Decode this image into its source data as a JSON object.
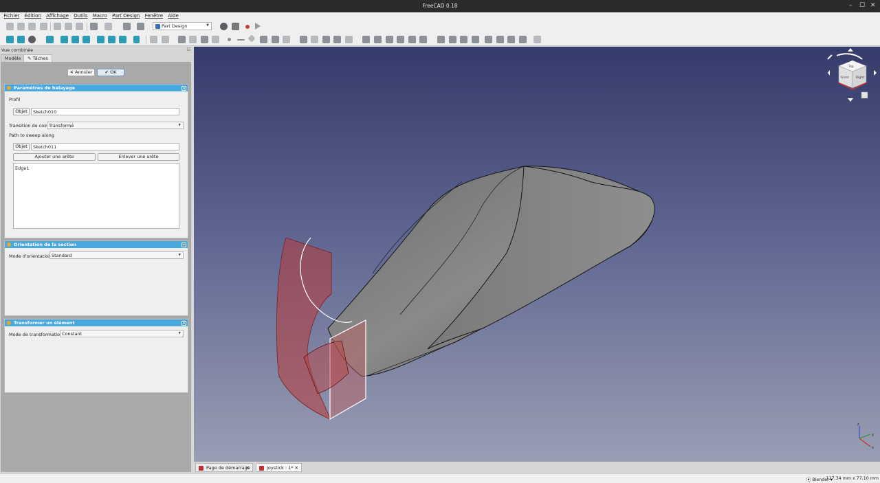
{
  "window": {
    "title": "FreeCAD 0.18",
    "minimize": "–",
    "maximize": "☐",
    "close": "✕"
  },
  "menu": [
    "Fichier",
    "Édition",
    "Affichage",
    "Macro",
    "Outils",
    "Macro",
    "Part Design",
    "Fenêtre",
    "Aide"
  ],
  "toolbar": {
    "workbench": "Part Design",
    "workbench_arrow": "▼"
  },
  "panel": {
    "title": "Vue combinée",
    "tabs": {
      "modele": "Modèle",
      "taches": "Tâches"
    },
    "buttons": {
      "annuler": "Annuler",
      "ok": "OK",
      "annuler_icon": "✕",
      "ok_icon": "✔"
    },
    "sweep": {
      "title": "Paramètres de balayage",
      "profil_label": "Profil",
      "objet1_btn": "Objet",
      "profile_value": "Sketch010",
      "transition_label": "Transition de coin",
      "transition_value": "Transformé",
      "path_label": "Path to sweep along",
      "objet2_btn": "Objet",
      "path_value": "Sketch011",
      "add_edge": "Ajouter une arête",
      "remove_edge": "Enlever une arête",
      "edges": [
        "Edge1"
      ]
    },
    "orientation": {
      "title": "Orientation de la section",
      "mode_label": "Mode d'orientation",
      "mode_value": "Standard"
    },
    "transform": {
      "title": "Transformer un élément",
      "mode_label": "Mode de transformation",
      "mode_value": "Constant"
    }
  },
  "navcube": {
    "top": "Top",
    "front": "Front",
    "right": "Right"
  },
  "axes": {
    "x": "x",
    "y": "y",
    "z": "z"
  },
  "doc_tabs": [
    {
      "label": "Page de démarrage"
    },
    {
      "label": "Joystick : 1*"
    }
  ],
  "status": {
    "nav_style": "Blender",
    "dimensions": "127,34 mm x 77,10 mm"
  },
  "colors": {
    "accent": "#48a8e0",
    "viewport_top": "#343b6a",
    "viewport_bottom": "#9a9eb3",
    "preview": "#b83a3a"
  }
}
